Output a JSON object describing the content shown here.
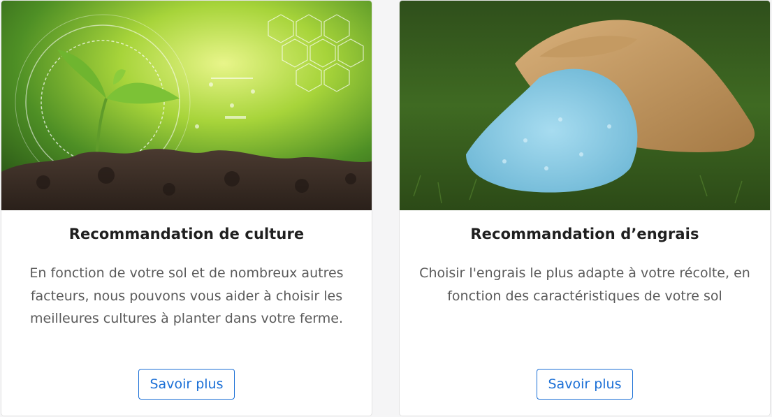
{
  "cards": [
    {
      "image_label": "seedling-technology-image",
      "title": "Recommandation de culture",
      "text": "En fonction de votre sol et de nombreux autres facteurs, nous pouvons vous aider à choisir les meilleures cultures à planter dans votre ferme.",
      "button": "Savoir plus"
    },
    {
      "image_label": "fertilizer-bag-image",
      "title": "Recommandation d’engrais",
      "text": "Choisir l'engrais le plus adapte à votre récolte, en fonction des caractéristiques de votre sol",
      "button": "Savoir plus"
    }
  ],
  "colors": {
    "accent": "#1a6fd6",
    "title": "#1f1f1f",
    "body_text": "#5a5a5a",
    "background": "#f5f5f6"
  }
}
